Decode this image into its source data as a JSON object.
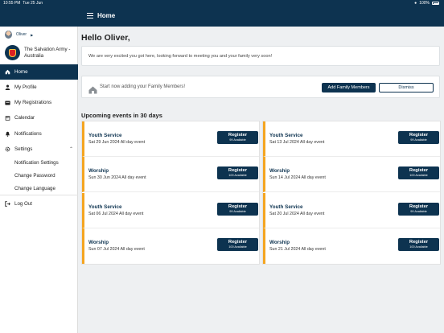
{
  "status_bar": {
    "time": "10:55 PM",
    "date": "Tue 25 Jun",
    "battery": "100%"
  },
  "header": {
    "title": "Home"
  },
  "sidebar": {
    "user_name": "Oliver",
    "org_line1": "The Salvation Army -",
    "org_line2": "Australia",
    "items": [
      {
        "label": "Home",
        "icon": "home-icon"
      },
      {
        "label": "My Profile",
        "icon": "person-icon"
      },
      {
        "label": "My Registrations",
        "icon": "ticket-icon"
      },
      {
        "label": "Calendar",
        "icon": "calendar-icon"
      },
      {
        "label": "Notifications",
        "icon": "bell-icon"
      },
      {
        "label": "Settings",
        "icon": "gear-icon"
      },
      {
        "label": "Log Out",
        "icon": "logout-icon"
      }
    ],
    "settings_sub": [
      "Notification Settings",
      "Change Password",
      "Change Language"
    ]
  },
  "main": {
    "greeting": "Hello Oliver,",
    "welcome": "We are very excited you got here, looking forward to meeting you and your family very soon!",
    "family_prompt": "Start now adding your Family Members!",
    "add_family_label": "Add Family Members",
    "dismiss_label": "Dismiss",
    "events_heading": "Upcoming events in 30 days",
    "register_label": "Register",
    "events_left": [
      {
        "title": "Youth Service",
        "date": "Sat 29 Jun  2024  All day event",
        "avail": "99 Available"
      },
      {
        "title": "Worship",
        "date": "Sun 30 Jun  2024  All day event",
        "avail": "100 Available"
      },
      {
        "title": "Youth Service",
        "date": "Sat 06 Jul  2024  All day event",
        "avail": "99 Available"
      },
      {
        "title": "Worship",
        "date": "Sun 07 Jul  2024  All day event",
        "avail": "100 Available"
      }
    ],
    "events_right": [
      {
        "title": "Youth Service",
        "date": "Sat 13 Jul  2024  All day event",
        "avail": "99 Available"
      },
      {
        "title": "Worship",
        "date": "Sun 14 Jul  2024  All day event",
        "avail": "100 Available"
      },
      {
        "title": "Youth Service",
        "date": "Sat 20 Jul  2024  All day event",
        "avail": "99 Available"
      },
      {
        "title": "Worship",
        "date": "Sun 21 Jul  2024  All day event",
        "avail": "100 Available"
      }
    ]
  },
  "colors": {
    "brand": "#0d3350",
    "accent": "#f4a521",
    "background": "#eef0f2"
  }
}
